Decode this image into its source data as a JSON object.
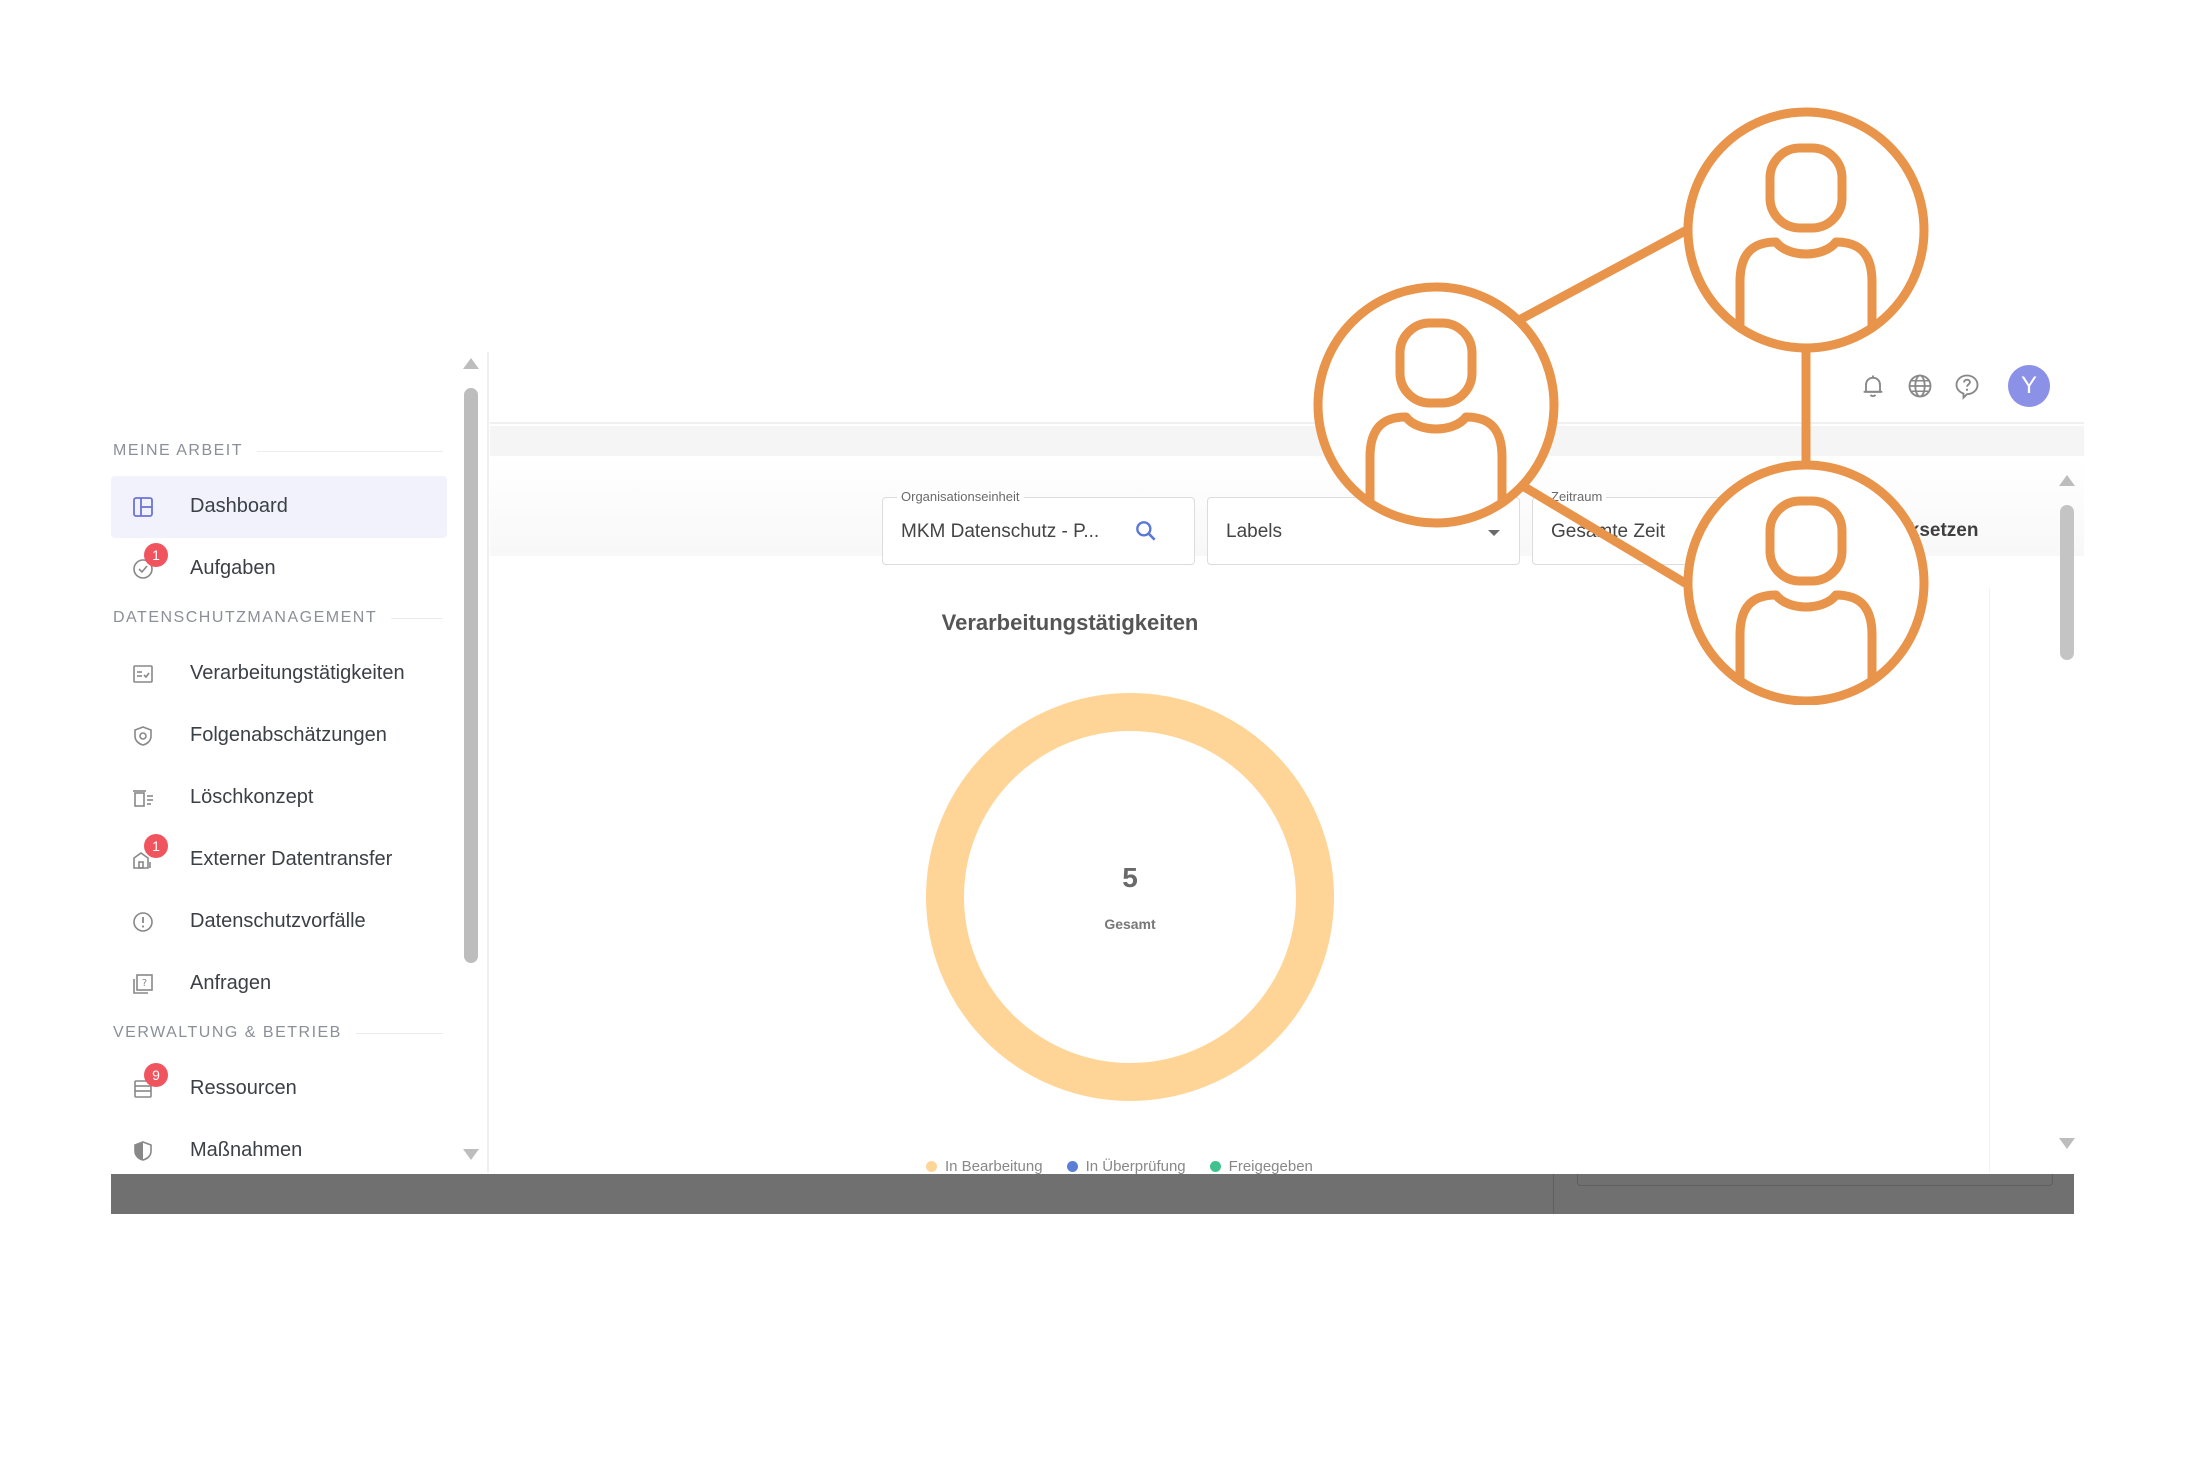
{
  "sidebar": {
    "sections": [
      {
        "title": "MEINE ARBEIT"
      },
      {
        "title": "DATENSCHUTZMANAGEMENT"
      },
      {
        "title": "VERWALTUNG & BETRIEB"
      }
    ],
    "items": [
      {
        "label": "Dashboard",
        "icon": "dashboard-icon",
        "active": true
      },
      {
        "label": "Aufgaben",
        "icon": "tasks-icon",
        "badge": "1"
      },
      {
        "label": "Verarbeitungstätigkeiten",
        "icon": "processing-list-icon"
      },
      {
        "label": "Folgenabschätzungen",
        "icon": "shield-search-icon"
      },
      {
        "label": "Löschkonzept",
        "icon": "trash-list-icon"
      },
      {
        "label": "Externer Datentransfer",
        "icon": "external-transfer-icon",
        "badge": "1"
      },
      {
        "label": "Datenschutzvorfälle",
        "icon": "alert-circle-icon"
      },
      {
        "label": "Anfragen",
        "icon": "request-icon"
      },
      {
        "label": "Ressourcen",
        "icon": "server-icon",
        "badge": "9"
      },
      {
        "label": "Maßnahmen",
        "icon": "shield-half-icon"
      }
    ]
  },
  "topbar": {
    "icons": [
      "bell-icon",
      "globe-icon",
      "help-icon"
    ],
    "avatar_initial": "Y"
  },
  "filters": {
    "org_unit": {
      "label": "Organisationseinheit",
      "value": "MKM Datenschutz - P..."
    },
    "labels": {
      "value": "Labels"
    },
    "period": {
      "label": "Zeitraum",
      "value": "Gesamte Zeit"
    },
    "reset_label": "Zurücksetzen"
  },
  "chart_data": {
    "type": "pie",
    "title": "Verarbeitungstätigkeiten",
    "total": "5",
    "total_label": "Gesamt",
    "series": [
      {
        "name": "In Bearbeitung",
        "value": 5,
        "color": "#ffd597"
      },
      {
        "name": "In Überprüfung",
        "value": 0,
        "color": "#5b7fd6"
      },
      {
        "name": "Freigegeben",
        "value": 0,
        "color": "#3fc28f"
      }
    ]
  },
  "colors": {
    "accent": "#8c91e8",
    "badge": "#f0555f",
    "network_orange": "#e8944a"
  },
  "overlay": {
    "icon": "people-network-icon"
  }
}
